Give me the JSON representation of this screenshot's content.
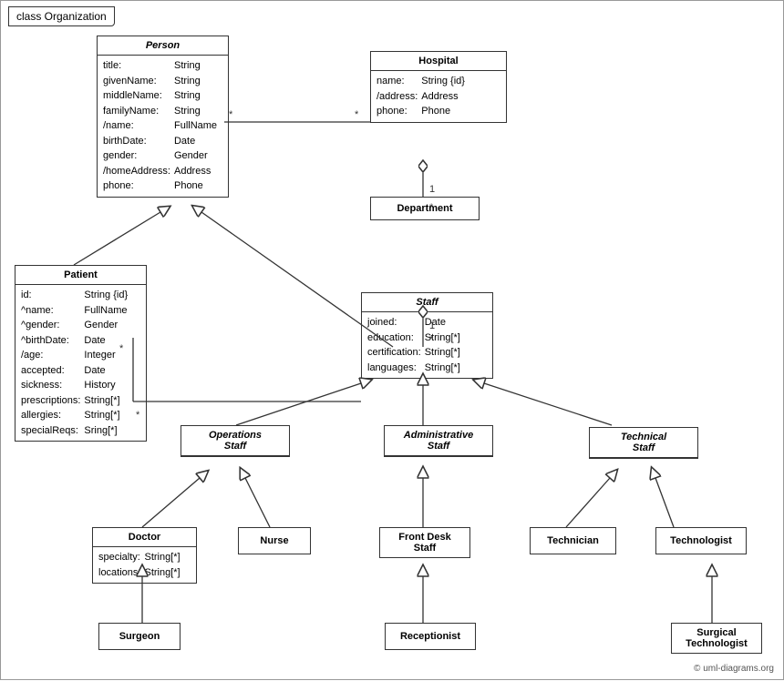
{
  "diagram": {
    "title": "class Organization",
    "copyright": "© uml-diagrams.org",
    "classes": {
      "person": {
        "name": "Person",
        "italic": true,
        "attributes": [
          [
            "title:",
            "String"
          ],
          [
            "givenName:",
            "String"
          ],
          [
            "middleName:",
            "String"
          ],
          [
            "familyName:",
            "String"
          ],
          [
            "/name:",
            "FullName"
          ],
          [
            "birthDate:",
            "Date"
          ],
          [
            "gender:",
            "Gender"
          ],
          [
            "/homeAddress:",
            "Address"
          ],
          [
            "phone:",
            "Phone"
          ]
        ]
      },
      "hospital": {
        "name": "Hospital",
        "italic": false,
        "attributes": [
          [
            "name:",
            "String {id}"
          ],
          [
            "/address:",
            "Address"
          ],
          [
            "phone:",
            "Phone"
          ]
        ]
      },
      "patient": {
        "name": "Patient",
        "italic": false,
        "attributes": [
          [
            "id:",
            "String {id}"
          ],
          [
            "^name:",
            "FullName"
          ],
          [
            "^gender:",
            "Gender"
          ],
          [
            "^birthDate:",
            "Date"
          ],
          [
            "/age:",
            "Integer"
          ],
          [
            "accepted:",
            "Date"
          ],
          [
            "sickness:",
            "History"
          ],
          [
            "prescriptions:",
            "String[*]"
          ],
          [
            "allergies:",
            "String[*]"
          ],
          [
            "specialReqs:",
            "Sring[*]"
          ]
        ]
      },
      "department": {
        "name": "Department",
        "italic": false,
        "attributes": []
      },
      "staff": {
        "name": "Staff",
        "italic": true,
        "attributes": [
          [
            "joined:",
            "Date"
          ],
          [
            "education:",
            "String[*]"
          ],
          [
            "certification:",
            "String[*]"
          ],
          [
            "languages:",
            "String[*]"
          ]
        ]
      },
      "operations_staff": {
        "name": "Operations\nStaff",
        "italic": true,
        "attributes": []
      },
      "administrative_staff": {
        "name": "Administrative\nStaff",
        "italic": true,
        "attributes": []
      },
      "technical_staff": {
        "name": "Technical\nStaff",
        "italic": true,
        "attributes": []
      },
      "doctor": {
        "name": "Doctor",
        "italic": false,
        "attributes": [
          [
            "specialty:",
            "String[*]"
          ],
          [
            "locations:",
            "String[*]"
          ]
        ]
      },
      "nurse": {
        "name": "Nurse",
        "italic": false,
        "attributes": []
      },
      "front_desk_staff": {
        "name": "Front Desk\nStaff",
        "italic": false,
        "attributes": []
      },
      "technician": {
        "name": "Technician",
        "italic": false,
        "attributes": []
      },
      "technologist": {
        "name": "Technologist",
        "italic": false,
        "attributes": []
      },
      "surgeon": {
        "name": "Surgeon",
        "italic": false,
        "attributes": []
      },
      "receptionist": {
        "name": "Receptionist",
        "italic": false,
        "attributes": []
      },
      "surgical_technologist": {
        "name": "Surgical\nTechnologist",
        "italic": false,
        "attributes": []
      }
    }
  }
}
